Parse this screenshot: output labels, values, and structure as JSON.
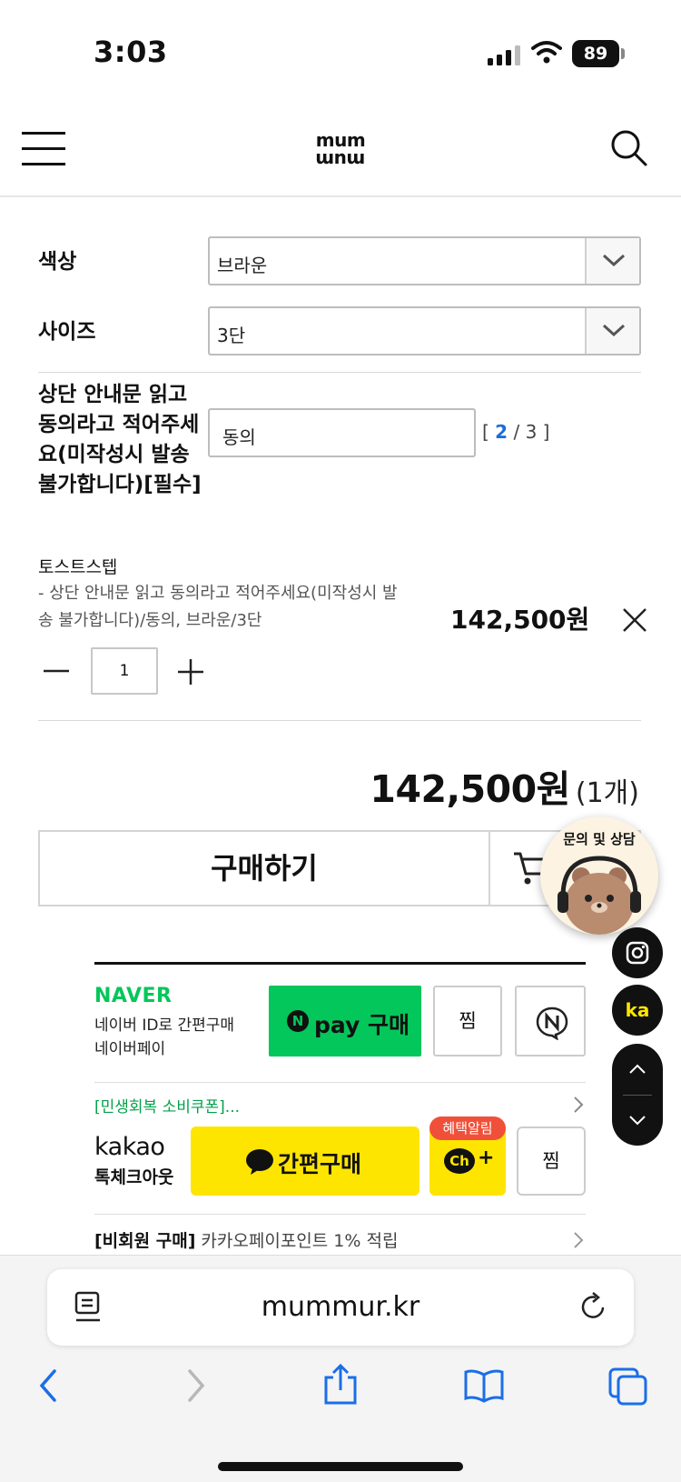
{
  "status": {
    "time": "3:03",
    "battery": "89"
  },
  "header": {
    "logo_top": "mum",
    "logo_bottom": "mum"
  },
  "options": {
    "color_label": "색상",
    "color_value": "브라운",
    "size_label": "사이즈",
    "size_value": "3단",
    "agree_label": "상단 안내문 읽고 동의라고 적어주세요(미작성시 발송 불가합니다)[필수]",
    "agree_value": "동의",
    "agree_counter_current": "2",
    "agree_counter_sep": "/",
    "agree_counter_max": "3"
  },
  "selected_item": {
    "name": "토스트스텝",
    "desc": "- 상단 안내문 읽고 동의라고 적어주세요(미작성시 발송 불가합니다)/동의, 브라운/3단",
    "price": "142,500원",
    "quantity": "1"
  },
  "total": {
    "amount": "142,500원",
    "count": "(1개)"
  },
  "actions": {
    "buy": "구매하기"
  },
  "floating": {
    "consult": "문의 및 상담",
    "kakao": "ka"
  },
  "naver": {
    "logo": "NAVER",
    "sub1": "네이버 ID로 간편구매",
    "sub2": "네이버페이",
    "pay_badge": "N",
    "pay_label": "pay 구매",
    "zzim": "찜",
    "coupon": "[민생회복 소비쿠폰]..."
  },
  "kakao": {
    "logo": "kakao",
    "sub": "톡체크아웃",
    "pay_label": "간편구매",
    "benefit": "혜택알림",
    "ch": "Ch",
    "ch_plus": "+",
    "zzim": "찜",
    "nonmember_bold": "[비회원 구매]",
    "nonmember_text": " 카카오페이포인트 1% 적립"
  },
  "browser": {
    "url": "mummur.kr"
  }
}
